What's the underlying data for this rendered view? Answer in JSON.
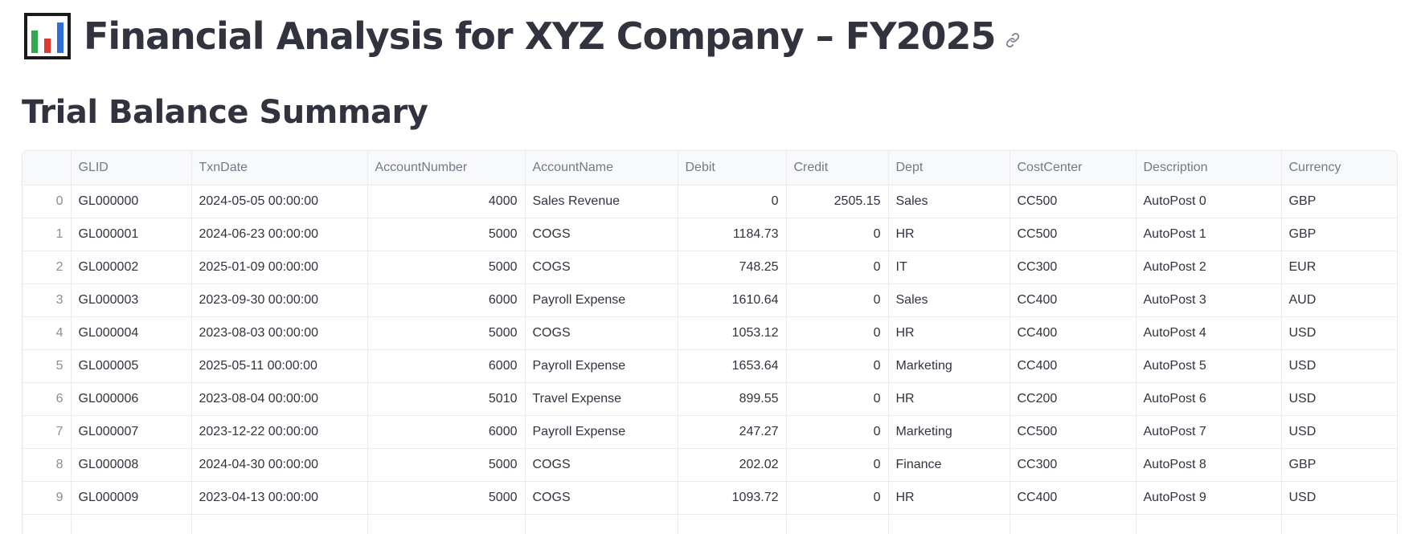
{
  "header": {
    "emoji_icon": "bar-chart-emoji-icon",
    "title": "Financial Analysis for XYZ Company – FY2025",
    "anchor_icon": "link-icon"
  },
  "section": {
    "subheading": "Trial Balance Summary"
  },
  "table": {
    "columns": [
      "",
      "GLID",
      "TxnDate",
      "AccountNumber",
      "AccountName",
      "Debit",
      "Credit",
      "Dept",
      "CostCenter",
      "Description",
      "Currency"
    ],
    "rows": [
      [
        "0",
        "GL000000",
        "2024-05-05 00:00:00",
        "4000",
        "Sales Revenue",
        "0",
        "2505.15",
        "Sales",
        "CC500",
        "AutoPost 0",
        "GBP"
      ],
      [
        "1",
        "GL000001",
        "2024-06-23 00:00:00",
        "5000",
        "COGS",
        "1184.73",
        "0",
        "HR",
        "CC500",
        "AutoPost 1",
        "GBP"
      ],
      [
        "2",
        "GL000002",
        "2025-01-09 00:00:00",
        "5000",
        "COGS",
        "748.25",
        "0",
        "IT",
        "CC300",
        "AutoPost 2",
        "EUR"
      ],
      [
        "3",
        "GL000003",
        "2023-09-30 00:00:00",
        "6000",
        "Payroll Expense",
        "1610.64",
        "0",
        "Sales",
        "CC400",
        "AutoPost 3",
        "AUD"
      ],
      [
        "4",
        "GL000004",
        "2023-08-03 00:00:00",
        "5000",
        "COGS",
        "1053.12",
        "0",
        "HR",
        "CC400",
        "AutoPost 4",
        "USD"
      ],
      [
        "5",
        "GL000005",
        "2025-05-11 00:00:00",
        "6000",
        "Payroll Expense",
        "1653.64",
        "0",
        "Marketing",
        "CC400",
        "AutoPost 5",
        "USD"
      ],
      [
        "6",
        "GL000006",
        "2023-08-04 00:00:00",
        "5010",
        "Travel Expense",
        "899.55",
        "0",
        "HR",
        "CC200",
        "AutoPost 6",
        "USD"
      ],
      [
        "7",
        "GL000007",
        "2023-12-22 00:00:00",
        "6000",
        "Payroll Expense",
        "247.27",
        "0",
        "Marketing",
        "CC500",
        "AutoPost 7",
        "USD"
      ],
      [
        "8",
        "GL000008",
        "2024-04-30 00:00:00",
        "5000",
        "COGS",
        "202.02",
        "0",
        "Finance",
        "CC300",
        "AutoPost 8",
        "GBP"
      ],
      [
        "9",
        "GL000009",
        "2023-04-13 00:00:00",
        "5000",
        "COGS",
        "1093.72",
        "0",
        "HR",
        "CC400",
        "AutoPost 9",
        "USD"
      ]
    ]
  },
  "colors": {
    "text": "#31333f",
    "header_bg": "#f8f9fb",
    "header_text": "#767884",
    "grid_line": "#ececef"
  }
}
